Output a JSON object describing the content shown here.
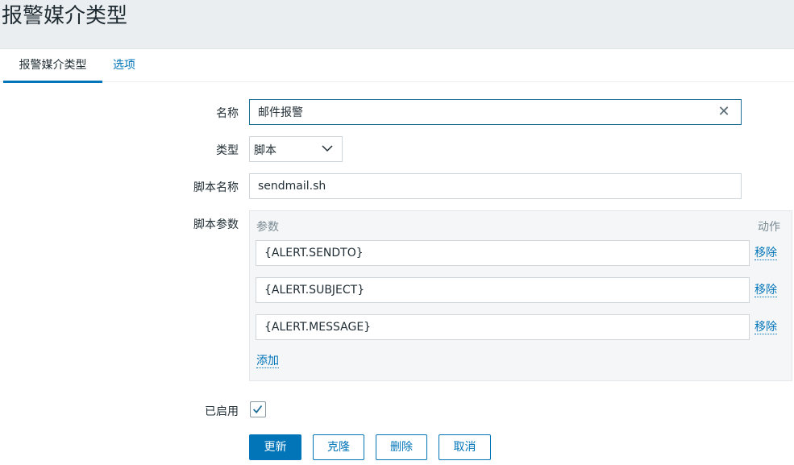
{
  "page": {
    "title": "报警媒介类型"
  },
  "tabs": [
    {
      "label": "报警媒介类型",
      "active": true
    },
    {
      "label": "选项",
      "active": false
    }
  ],
  "form": {
    "name": {
      "label": "名称",
      "value": "邮件报警"
    },
    "type": {
      "label": "类型",
      "value": "脚本"
    },
    "script_name": {
      "label": "脚本名称",
      "value": "sendmail.sh"
    },
    "script_params": {
      "label": "脚本参数",
      "col_param": "参数",
      "col_action": "动作",
      "rows": [
        {
          "value": "{ALERT.SENDTO}",
          "remove_label": "移除"
        },
        {
          "value": "{ALERT.SUBJECT}",
          "remove_label": "移除"
        },
        {
          "value": "{ALERT.MESSAGE}",
          "remove_label": "移除"
        }
      ],
      "add_label": "添加"
    },
    "enabled": {
      "label": "已启用",
      "checked": true
    }
  },
  "buttons": {
    "update": "更新",
    "clone": "克隆",
    "delete": "删除",
    "cancel": "取消"
  },
  "colors": {
    "accent": "#0275b8",
    "background": "#ebeef0"
  },
  "icons": {
    "clear": "close-icon",
    "dropdown": "chevron-down-icon",
    "check": "check-icon"
  }
}
